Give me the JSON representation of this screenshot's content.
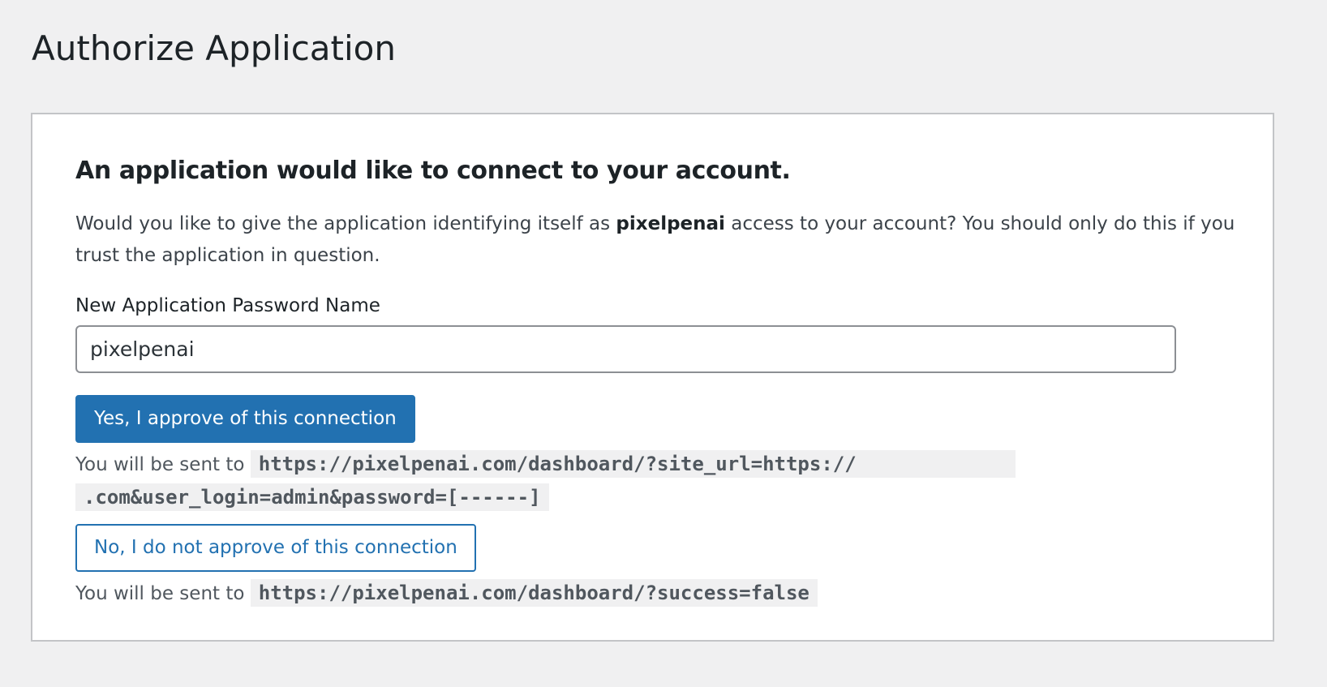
{
  "page": {
    "title": "Authorize Application"
  },
  "card": {
    "heading": "An application would like to connect to your account.",
    "intro_prefix": "Would you like to give the application identifying itself as ",
    "app_name": "pixelpenai",
    "intro_suffix": " access to your account? You should only do this if you trust the application in question."
  },
  "form": {
    "label": "New Application Password Name",
    "input_value": "pixelpenai"
  },
  "approve": {
    "button_label": "Yes, I approve of this connection",
    "redirect_prefix": "You will be sent to",
    "redirect_url_part1": "https://pixelpenai.com/dashboard/?site_url=https://",
    "redirect_url_part2": ".com&user_login=admin&password=[------]"
  },
  "reject": {
    "button_label": "No, I do not approve of this connection",
    "redirect_prefix": "You will be sent to",
    "redirect_url": "https://pixelpenai.com/dashboard/?success=false"
  },
  "colors": {
    "accent": "#2271b1",
    "background": "#f0f0f1",
    "card": "#ffffff"
  }
}
